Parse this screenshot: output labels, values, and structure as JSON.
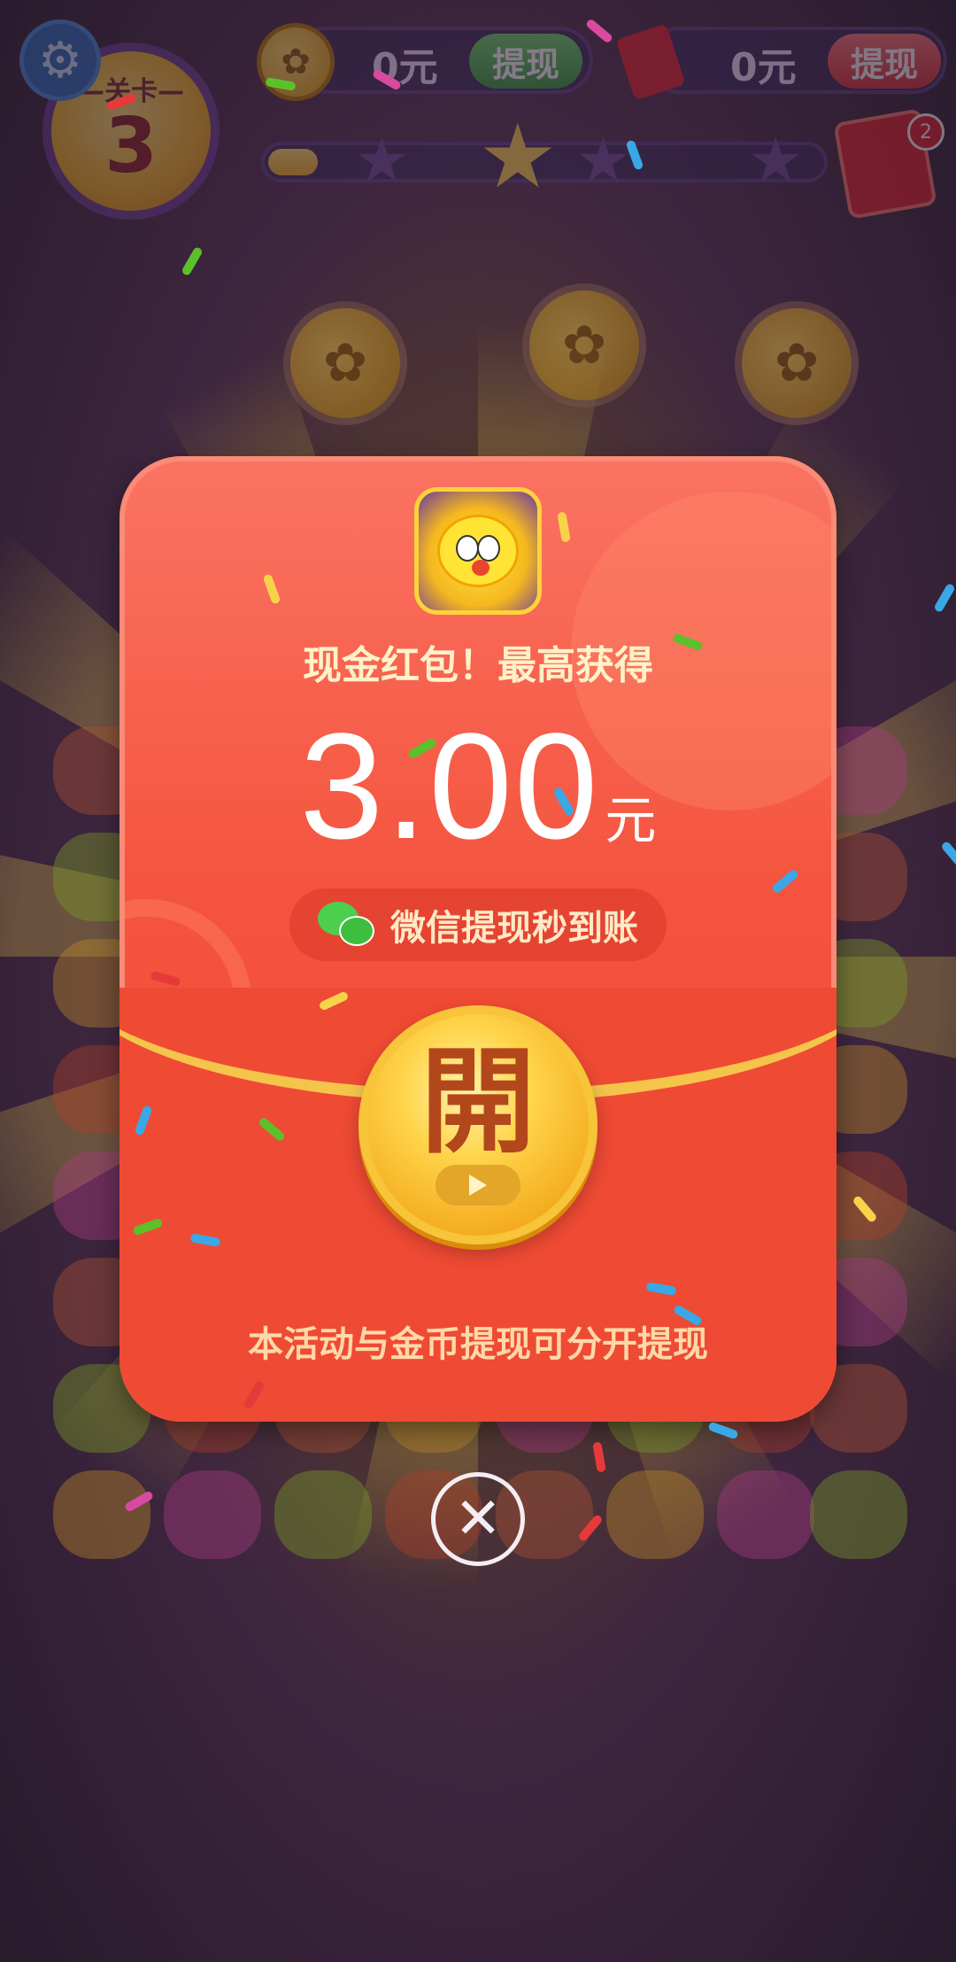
{
  "hud": {
    "settings_icon": "gear-icon",
    "level_label": "—关卡—",
    "level_number": "3",
    "coin_amount": "0元",
    "coin_withdraw_label": "提现",
    "redpack_amount": "0元",
    "redpack_withdraw_label": "提现",
    "progress_fraction": 0.09,
    "redpack_badge_count": "2"
  },
  "modal": {
    "headline": "现金红包！最高获得",
    "amount_value": "3.00",
    "amount_unit": "元",
    "wechat_text": "微信提现秒到账",
    "open_label": "開",
    "note": "本活动与金币提现可分开提现"
  },
  "close_icon": "close-icon",
  "colors": {
    "packet_red": "#f04636",
    "gold": "#ffd44a",
    "headline": "#fff2c8",
    "withdraw_green": "#2e9e3a",
    "withdraw_red": "#e0303a"
  }
}
